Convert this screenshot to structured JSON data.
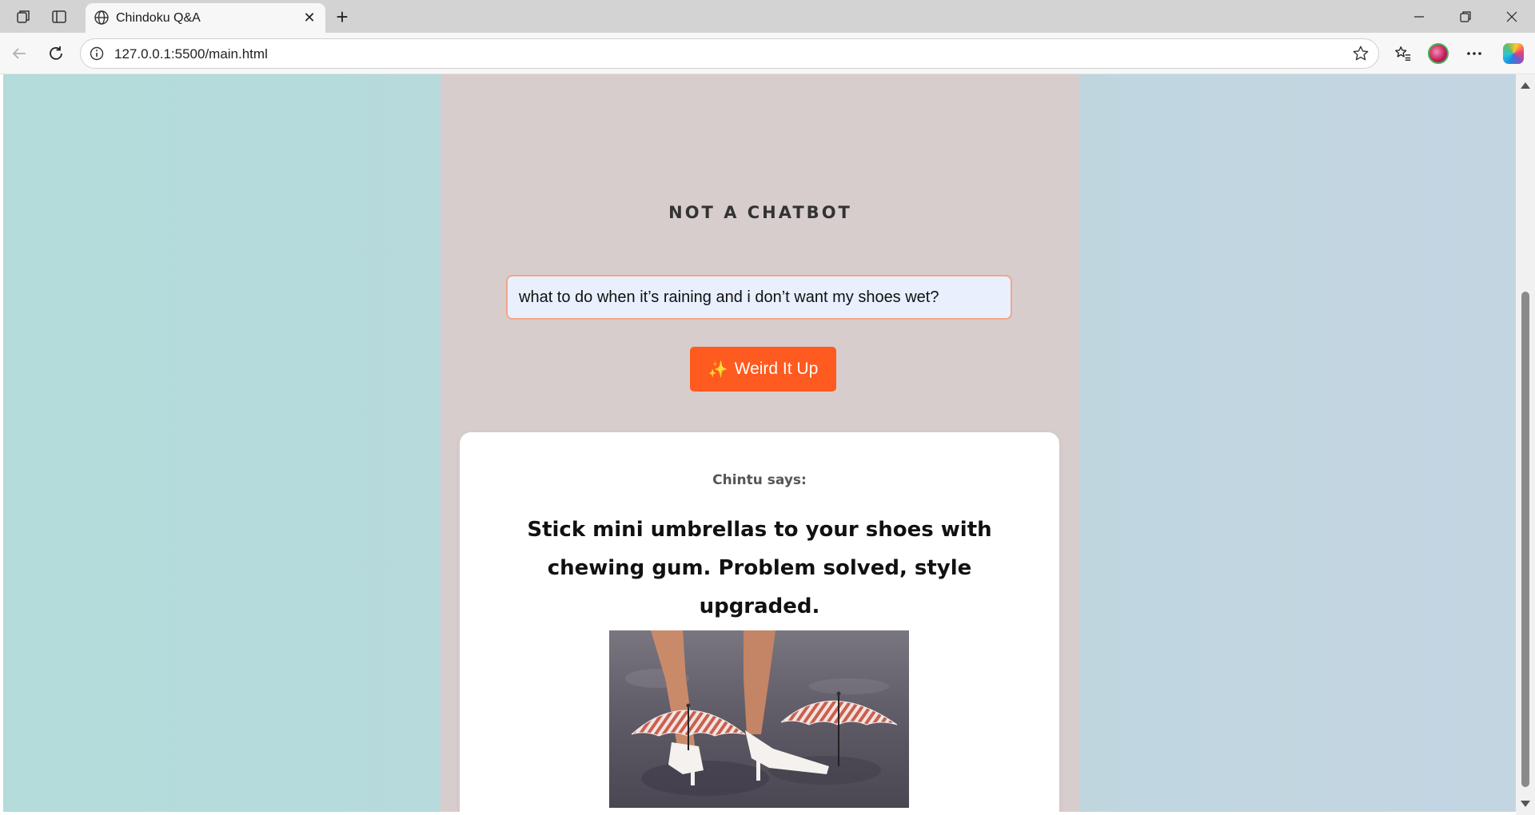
{
  "browser": {
    "tab_title": "Chindoku Q&A",
    "url": "127.0.0.1:5500/main.html",
    "icons": [
      "workspaces-icon",
      "tab-actions-icon",
      "globe-icon",
      "close-icon",
      "plus-icon",
      "minimize-icon",
      "restore-icon",
      "window-close-icon",
      "back-icon",
      "refresh-icon",
      "info-icon",
      "star-icon",
      "favorites-icon",
      "profile-avatar",
      "more-icon",
      "copilot-icon"
    ]
  },
  "page": {
    "title": "NOT A CHATBOT",
    "question_value": "what to do when it’s raining and i don’t want my shoes wet?",
    "button_label": "Weird It Up",
    "button_icon": "sparkles-icon",
    "answer_header": "Chintu says:",
    "answer_text": "Stick mini umbrellas to your shoes with chewing gum. Problem solved, style upgraded.",
    "image_description_icon": "shoe-umbrellas-photo",
    "colors": {
      "accent": "#ff5a1f",
      "panel": "#d8cdcd",
      "background_left": "#b3dcdb",
      "background_right": "#c4d5e2",
      "input_bg": "#e8f0fe",
      "input_border": "#f4a58a"
    }
  }
}
